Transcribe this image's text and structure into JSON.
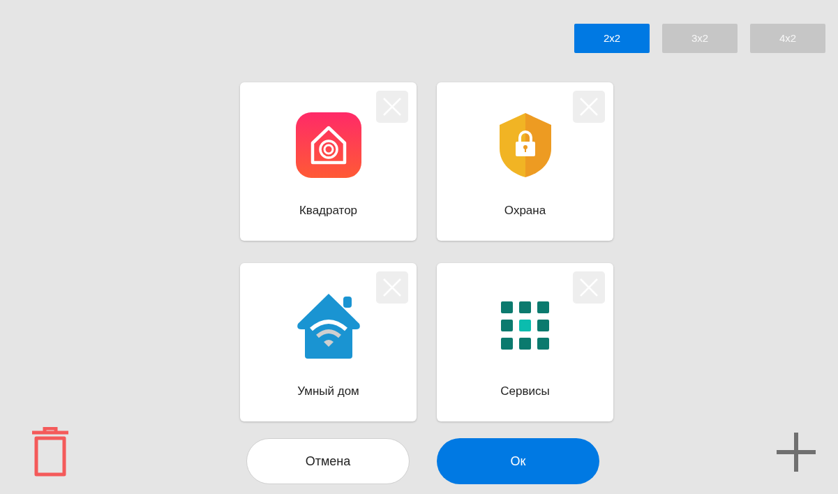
{
  "layout_options": [
    {
      "label": "2x2",
      "selected": true
    },
    {
      "label": "3x2",
      "selected": false
    },
    {
      "label": "4x2",
      "selected": false
    }
  ],
  "apps": [
    {
      "label": "Квадратор",
      "kind": "camera-home"
    },
    {
      "label": "Охрана",
      "kind": "shield-lock"
    },
    {
      "label": "Умный дом",
      "kind": "wifi-home"
    },
    {
      "label": "Сервисы",
      "kind": "grid"
    }
  ],
  "buttons": {
    "cancel": "Отмена",
    "ok": "Ок"
  }
}
